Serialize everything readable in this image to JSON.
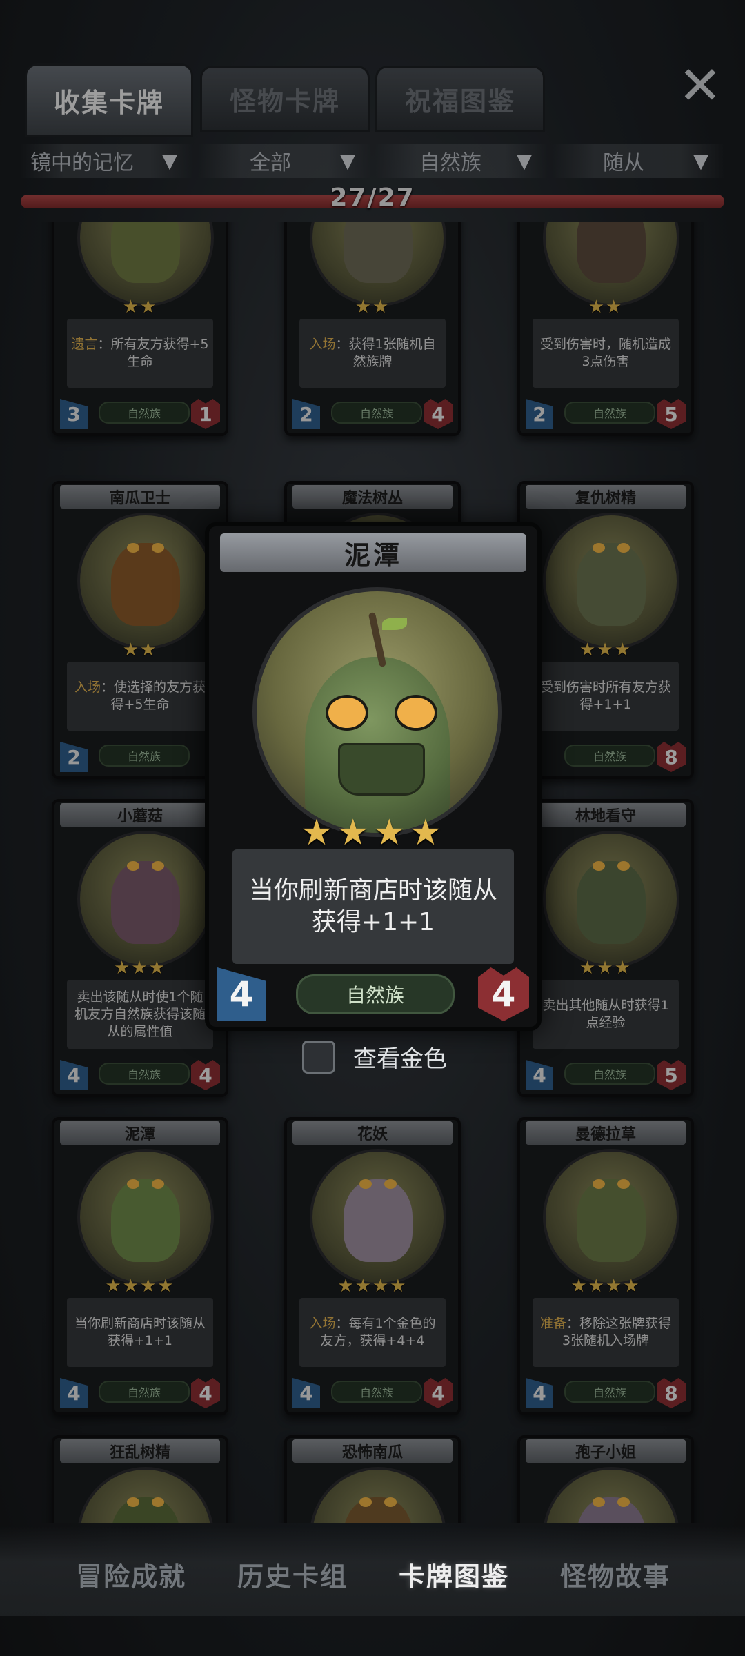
{
  "tabs": [
    {
      "label": "收集卡牌",
      "active": true
    },
    {
      "label": "怪物卡牌",
      "active": false
    },
    {
      "label": "祝福图鉴",
      "active": false
    }
  ],
  "close_icon": "close-icon",
  "filters": [
    {
      "label": "镜中的记忆"
    },
    {
      "label": "全部"
    },
    {
      "label": "自然族"
    },
    {
      "label": "随从"
    }
  ],
  "progress": {
    "text": "27/27",
    "fraction": 1.0
  },
  "cards": [
    {
      "name": "",
      "desc": [
        "遗言",
        "：所有友方获得+5生命"
      ],
      "stars": "★★",
      "tribe": "自然族",
      "atk": "3",
      "hp": "1"
    },
    {
      "name": "",
      "desc": [
        "入场",
        "：获得1张随机自然族牌"
      ],
      "stars": "★★",
      "tribe": "自然族",
      "atk": "2",
      "hp": "4"
    },
    {
      "name": "",
      "desc": [
        "",
        "受到伤害时，随机造成3点伤害"
      ],
      "stars": "★★",
      "tribe": "自然族",
      "atk": "2",
      "hp": "5"
    },
    {
      "name": "南瓜卫士",
      "desc": [
        "入场",
        "：使选择的友方获得+5生命"
      ],
      "stars": "★★",
      "tribe": "自然族",
      "atk": "2",
      "hp": ""
    },
    {
      "name": "魔法树丛",
      "desc": [
        "",
        ""
      ],
      "stars": "",
      "tribe": "",
      "atk": "",
      "hp": ""
    },
    {
      "name": "复仇树精",
      "desc": [
        "",
        "受到伤害时所有友方获得+1+1"
      ],
      "stars": "★★★",
      "tribe": "自然族",
      "atk": "",
      "hp": "8"
    },
    {
      "name": "小蘑菇",
      "desc": [
        "",
        "卖出该随从时使1个随机友方自然族获得该随从的属性值"
      ],
      "stars": "★★★",
      "tribe": "自然族",
      "atk": "4",
      "hp": "4"
    },
    {
      "name": "",
      "desc": [
        "",
        ""
      ],
      "stars": "",
      "tribe": "",
      "atk": "",
      "hp": ""
    },
    {
      "name": "林地看守",
      "desc": [
        "",
        "卖出其他随从时获得1点经验"
      ],
      "stars": "★★★",
      "tribe": "自然族",
      "atk": "4",
      "hp": "5"
    },
    {
      "name": "泥潭",
      "desc": [
        "",
        "当你刷新商店时该随从获得+1+1"
      ],
      "stars": "★★★★",
      "tribe": "自然族",
      "atk": "4",
      "hp": "4"
    },
    {
      "name": "花妖",
      "desc": [
        "入场",
        "：每有1个金色的友方，获得+4+4"
      ],
      "stars": "★★★★",
      "tribe": "自然族",
      "atk": "4",
      "hp": "4"
    },
    {
      "name": "曼德拉草",
      "desc": [
        "准备",
        "：移除这张牌获得3张随机入场牌"
      ],
      "stars": "★★★★",
      "tribe": "自然族",
      "atk": "4",
      "hp": "8"
    },
    {
      "name": "狂乱树精",
      "desc": [
        "",
        ""
      ],
      "stars": "",
      "tribe": "",
      "atk": "",
      "hp": ""
    },
    {
      "name": "恐怖南瓜",
      "desc": [
        "",
        ""
      ],
      "stars": "",
      "tribe": "",
      "atk": "",
      "hp": ""
    },
    {
      "name": "孢子小姐",
      "desc": [
        "",
        ""
      ],
      "stars": "",
      "tribe": "",
      "atk": "",
      "hp": ""
    }
  ],
  "popup": {
    "name": "泥潭",
    "stars": "★★★★",
    "desc": "当你刷新商店时该随从获得+1+1",
    "tribe": "自然族",
    "atk": "4",
    "hp": "4"
  },
  "gold_toggle": {
    "label": "查看金色",
    "checked": false
  },
  "bottom_nav": [
    {
      "label": "冒险成就",
      "active": false
    },
    {
      "label": "历史卡组",
      "active": false
    },
    {
      "label": "卡牌图鉴",
      "active": true
    },
    {
      "label": "怪物故事",
      "active": false
    }
  ],
  "colors": {
    "accent_red": "#b04848",
    "star_gold": "#e1b74c",
    "keyword_gold": "#e2b350"
  }
}
